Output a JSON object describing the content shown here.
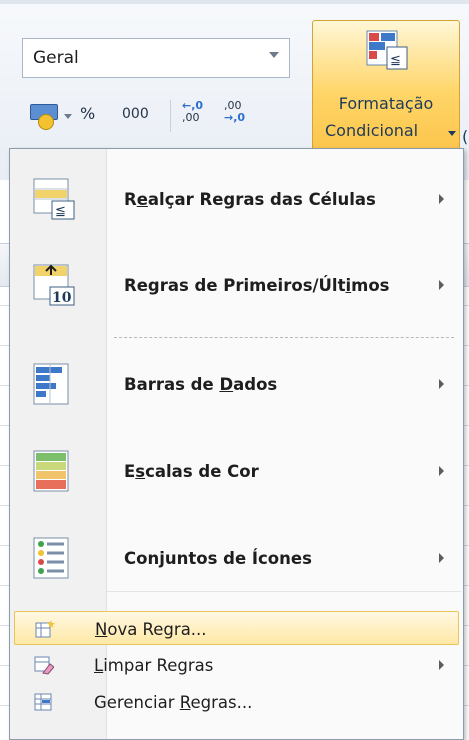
{
  "number_group": {
    "format_value": "Geral",
    "percent_label": "%",
    "thousands_label": "000",
    "increase_decimal": {
      "top": "←,0",
      "bottom": ",00"
    },
    "decrease_decimal": {
      "top": ",00",
      "bottom": "→,0"
    }
  },
  "cf_button": {
    "line1": "Formatação",
    "line2": "Condicional",
    "cut_char": "("
  },
  "menu": {
    "items": [
      {
        "pre": "R",
        "ul": "e",
        "post": "alçar Regras das Células",
        "icon": "highlight-cells-rules-icon",
        "submenu": true
      },
      {
        "pre": "Regras de Primeiros/Últ",
        "ul": "i",
        "post": "mos",
        "icon": "top-bottom-rules-icon",
        "submenu": true
      },
      {
        "pre": "Barras de ",
        "ul": "D",
        "post": "ados",
        "icon": "data-bars-icon",
        "submenu": true
      },
      {
        "pre": "E",
        "ul": "s",
        "post": "calas de Cor",
        "icon": "color-scales-icon",
        "submenu": true
      },
      {
        "pre": "Con",
        "ul": "j",
        "post": "untos de Ícones",
        "icon": "icon-sets-icon",
        "submenu": true
      }
    ],
    "small_items": [
      {
        "pre": "",
        "ul": "N",
        "post": "ova Regra...",
        "icon": "new-rule-icon",
        "submenu": false
      },
      {
        "pre": "",
        "ul": "L",
        "post": "impar Regras",
        "icon": "clear-rules-icon",
        "submenu": true
      },
      {
        "pre": "Gerenciar ",
        "ul": "R",
        "post": "egras...",
        "icon": "manage-rules-icon",
        "submenu": false
      }
    ]
  },
  "colors": {
    "hover_bg": "#ffe8a6",
    "cf_button_bg": "#ffd568",
    "menu_border": "#8e9bab"
  }
}
